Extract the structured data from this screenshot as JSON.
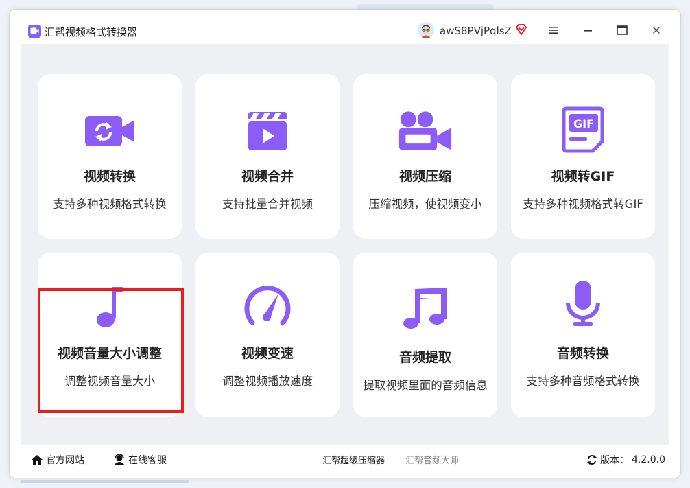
{
  "app": {
    "title": "汇帮视频格式转换器",
    "username": "awS8PVjPqlsZ"
  },
  "window_controls": [
    "menu-icon",
    "minimize-icon",
    "maximize-icon",
    "close-icon"
  ],
  "colors": {
    "accent": "#8b5cf6",
    "highlight": "#ee1b1b",
    "content_bg": "#eef0f4",
    "card_bg": "#ffffff"
  },
  "cards": [
    {
      "icon": "video-convert-icon",
      "title": "视频转换",
      "desc": "支持多种视频格式转换"
    },
    {
      "icon": "video-merge-icon",
      "title": "视频合并",
      "desc": "支持批量合并视频"
    },
    {
      "icon": "video-compress-icon",
      "title": "视频压缩",
      "desc": "压缩视频，使视频变小"
    },
    {
      "icon": "gif-icon",
      "title": "视频转GIF",
      "desc": "支持多种视频格式转GIF"
    },
    {
      "icon": "music-note-icon",
      "title": "视频音量大小调整",
      "desc": "调整视频音量大小"
    },
    {
      "icon": "speedometer-icon",
      "title": "视频变速",
      "desc": "调整视频播放速度"
    },
    {
      "icon": "music-notes-icon",
      "title": "音频提取",
      "desc": "提取视频里面的音频信息"
    },
    {
      "icon": "microphone-icon",
      "title": "音频转换",
      "desc": "支持多种音频格式转换"
    }
  ],
  "footer": {
    "website": "官方网站",
    "support": "在线客服",
    "link1": "汇帮超级压缩器",
    "link2": "汇帮音频大师",
    "version_label": "版本：",
    "version": "4.2.0.0"
  }
}
